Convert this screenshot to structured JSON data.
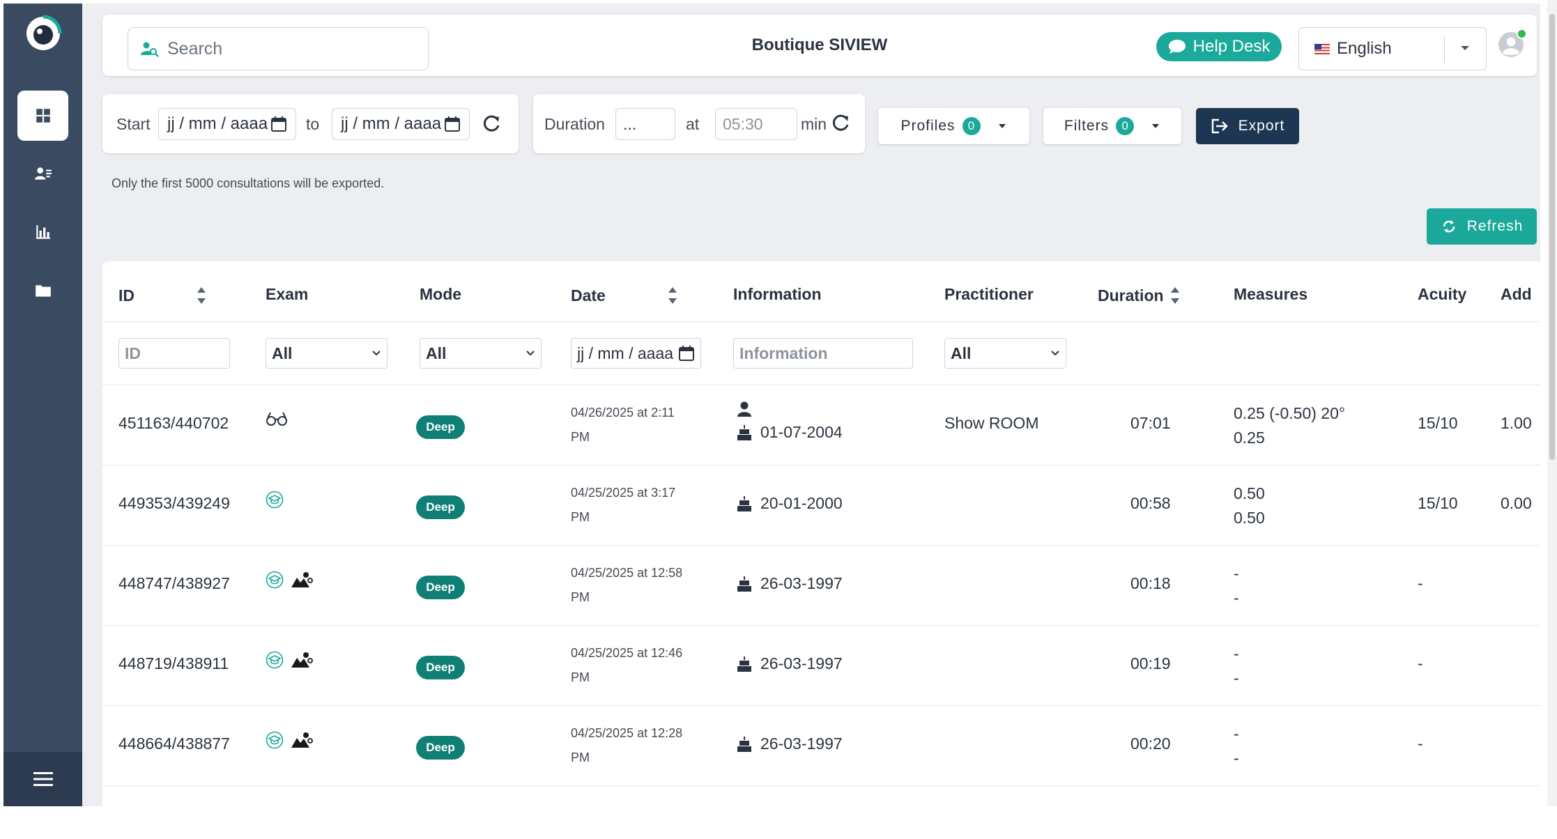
{
  "topbar": {
    "search_placeholder": "Search",
    "store_name": "Boutique SIVIEW",
    "help_desk_label": "Help Desk",
    "language": "English"
  },
  "sidebar": {
    "items": [
      {
        "icon": "dashboard-icon",
        "active": true
      },
      {
        "icon": "patients-icon",
        "active": false
      },
      {
        "icon": "statistics-icon",
        "active": false
      },
      {
        "icon": "folder-icon",
        "active": false
      }
    ],
    "menu_icon": "hamburger-menu-icon"
  },
  "filters": {
    "start_label": "Start",
    "start_value": "jj / mm / aaaa",
    "to_label": "to",
    "end_value": "jj / mm / aaaa",
    "duration_label": "Duration",
    "duration_value": "...",
    "at_label": "at",
    "at_placeholder": "05:30",
    "min_label": "min",
    "profiles_label": "Profiles",
    "profiles_count": "0",
    "filters_label": "Filters",
    "filters_count": "0",
    "export_label": "Export",
    "note": "Only the first 5000 consultations will be exported.",
    "refresh_label": "Refresh"
  },
  "table": {
    "headers": {
      "id": "ID",
      "exam": "Exam",
      "mode": "Mode",
      "date": "Date",
      "information": "Information",
      "practitioner": "Practitioner",
      "duration": "Duration",
      "measures": "Measures",
      "acuity": "Acuity",
      "add": "Add"
    },
    "filter_row": {
      "id_placeholder": "ID",
      "exam_value": "All",
      "mode_value": "All",
      "date_value": "jj / mm / aaaa",
      "information_placeholder": "Information",
      "practitioner_value": "All"
    },
    "rows": [
      {
        "id": "451163/440702",
        "exam_icons": [
          "glasses-icon"
        ],
        "mode": "Deep",
        "date_line1": "04/26/2025 at 2:11",
        "date_line2": "PM",
        "has_person": true,
        "birthdate": "01-07-2004",
        "practitioner": "Show ROOM",
        "duration": "07:01",
        "measure1": "0.25 (-0.50) 20°",
        "measure2": "0.25",
        "acuity": "15/10",
        "add": "1.00"
      },
      {
        "id": "449353/439249",
        "exam_icons": [
          "graduation-cap-icon"
        ],
        "mode": "Deep",
        "date_line1": "04/25/2025 at 3:17",
        "date_line2": "PM",
        "has_person": false,
        "birthdate": "20-01-2000",
        "practitioner": "",
        "duration": "00:58",
        "measure1": "0.50",
        "measure2": "0.50",
        "acuity": "15/10",
        "add": "0.00"
      },
      {
        "id": "448747/438927",
        "exam_icons": [
          "graduation-cap-icon",
          "landscape-icon"
        ],
        "mode": "Deep",
        "date_line1": "04/25/2025 at 12:58",
        "date_line2": "PM",
        "has_person": false,
        "birthdate": "26-03-1997",
        "practitioner": "",
        "duration": "00:18",
        "measure1": "-",
        "measure2": "-",
        "acuity": "-",
        "add": ""
      },
      {
        "id": "448719/438911",
        "exam_icons": [
          "graduation-cap-icon",
          "landscape-icon"
        ],
        "mode": "Deep",
        "date_line1": "04/25/2025 at 12:46",
        "date_line2": "PM",
        "has_person": false,
        "birthdate": "26-03-1997",
        "practitioner": "",
        "duration": "00:19",
        "measure1": "-",
        "measure2": "-",
        "acuity": "-",
        "add": ""
      },
      {
        "id": "448664/438877",
        "exam_icons": [
          "graduation-cap-icon",
          "landscape-icon"
        ],
        "mode": "Deep",
        "date_line1": "04/25/2025 at 12:28",
        "date_line2": "PM",
        "has_person": false,
        "birthdate": "26-03-1997",
        "practitioner": "",
        "duration": "00:20",
        "measure1": "-",
        "measure2": "-",
        "acuity": "-",
        "add": ""
      }
    ]
  },
  "colors": {
    "sidebar": "#3a4b61",
    "teal": "#1aa99a",
    "deep_badge": "#107f75",
    "export": "#1d3651"
  }
}
